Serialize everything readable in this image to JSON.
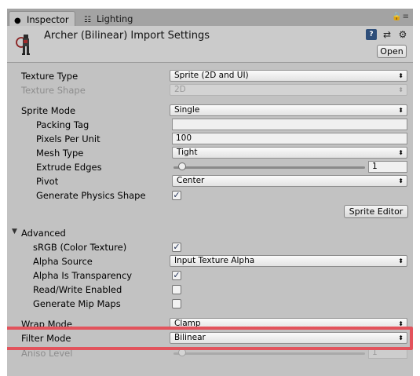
{
  "tabs": [
    {
      "label": "Inspector",
      "icon": "info-icon"
    },
    {
      "label": "Lighting",
      "icon": "lighting-icon"
    }
  ],
  "header": {
    "title": "Archer (Bilinear) Import Settings",
    "open_label": "Open"
  },
  "settings": {
    "texture_type": {
      "label": "Texture Type",
      "value": "Sprite (2D and UI)"
    },
    "texture_shape": {
      "label": "Texture Shape",
      "value": "2D"
    },
    "sprite_mode": {
      "label": "Sprite Mode",
      "value": "Single"
    },
    "packing_tag": {
      "label": "Packing Tag",
      "value": ""
    },
    "pixels_per_unit": {
      "label": "Pixels Per Unit",
      "value": "100"
    },
    "mesh_type": {
      "label": "Mesh Type",
      "value": "Tight"
    },
    "extrude_edges": {
      "label": "Extrude Edges",
      "value": "1"
    },
    "pivot": {
      "label": "Pivot",
      "value": "Center"
    },
    "generate_physics_shape": {
      "label": "Generate Physics Shape",
      "checked": true
    },
    "sprite_editor_label": "Sprite Editor"
  },
  "advanced": {
    "label": "Advanced",
    "srgb": {
      "label": "sRGB (Color Texture)",
      "checked": true
    },
    "alpha_source": {
      "label": "Alpha Source",
      "value": "Input Texture Alpha"
    },
    "alpha_is_transparency": {
      "label": "Alpha Is Transparency",
      "checked": true
    },
    "read_write": {
      "label": "Read/Write Enabled",
      "checked": false
    },
    "mip_maps": {
      "label": "Generate Mip Maps",
      "checked": false
    }
  },
  "wrap_mode": {
    "label": "Wrap Mode",
    "value": "Clamp"
  },
  "filter_mode": {
    "label": "Filter Mode",
    "value": "Bilinear"
  },
  "aniso_level": {
    "label": "Aniso Level",
    "value": "1"
  },
  "colors": {
    "highlight": "#e2535c",
    "panel": "#c2c2c2"
  }
}
